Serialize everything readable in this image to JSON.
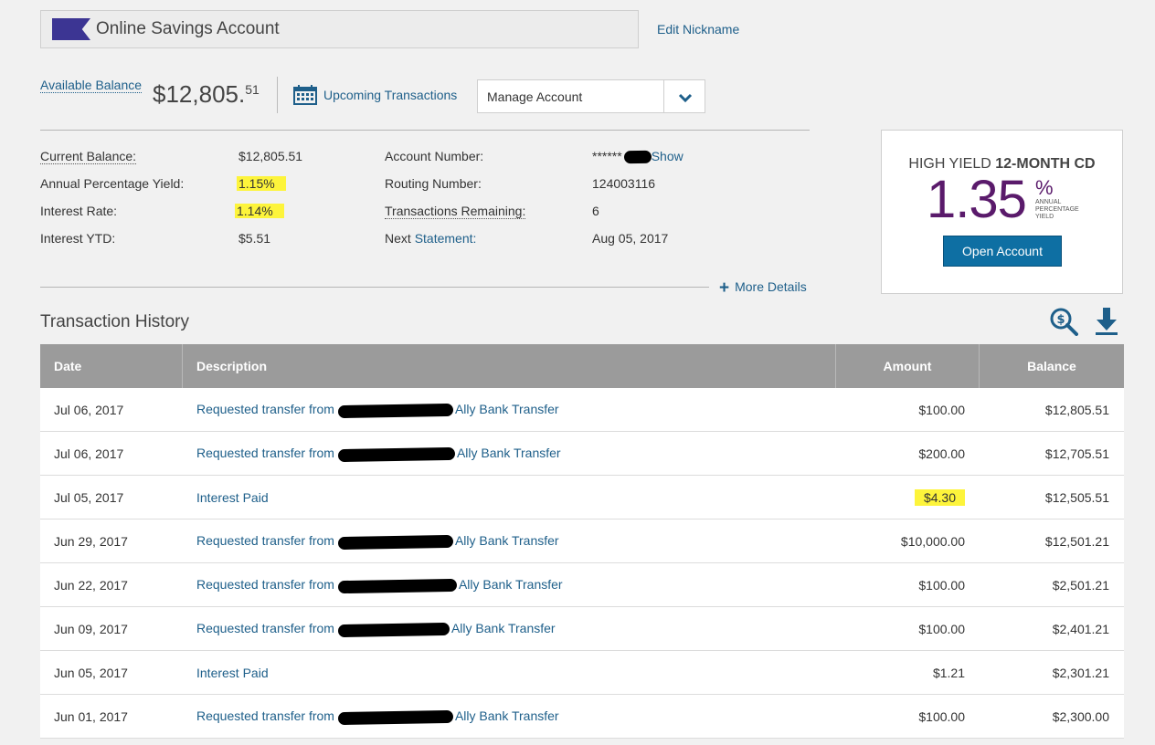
{
  "header": {
    "account_nickname": "Online Savings Account",
    "edit_nickname": "Edit Nickname"
  },
  "balance": {
    "available_label": "Available Balance",
    "amount_main": "$12,805.",
    "amount_cents": "51",
    "upcoming_label": "Upcoming Transactions",
    "manage_account": "Manage Account"
  },
  "details": {
    "current_balance_label": "Current Balance:",
    "current_balance_value": "$12,805.51",
    "apy_label": "Annual Percentage Yield:",
    "apy_value": "1.15%",
    "interest_rate_label": "Interest Rate:",
    "interest_rate_value": "1.14%",
    "interest_ytd_label": "Interest YTD:",
    "interest_ytd_value": "$5.51",
    "account_number_label": "Account Number:",
    "account_number_value": "******",
    "account_number_show": "Show",
    "routing_number_label": "Routing Number:",
    "routing_number_value": "124003116",
    "transactions_remaining_label": "Transactions Remaining:",
    "transactions_remaining_value": "6",
    "next_label": "Next",
    "statement_label": "Statement:",
    "next_statement_value": "Aug 05, 2017",
    "more_details": "More Details"
  },
  "promo": {
    "title_prefix": "HIGH YIELD",
    "title_bold": "12-MONTH CD",
    "rate": "1.35",
    "percent": "%",
    "apy_line1": "ANNUAL",
    "apy_line2": "PERCENTAGE",
    "apy_line3": "YIELD",
    "open_button": "Open Account"
  },
  "history": {
    "title": "Transaction History",
    "columns": {
      "date": "Date",
      "description": "Description",
      "amount": "Amount",
      "balance": "Balance"
    },
    "rows": [
      {
        "date": "Jul 06, 2017",
        "desc_a": "Requested transfer from",
        "desc_b": "Ally Bank Transfer",
        "amount": "$100.00",
        "balance": "$12,805.51"
      },
      {
        "date": "Jul 06, 2017",
        "desc_a": "Requested transfer from",
        "desc_b": "Ally Bank Transfer",
        "amount": "$200.00",
        "balance": "$12,705.51"
      },
      {
        "date": "Jul 05, 2017",
        "desc_a": "Interest Paid",
        "desc_b": "",
        "amount": "$4.30",
        "balance": "$12,505.51"
      },
      {
        "date": "Jun 29, 2017",
        "desc_a": "Requested transfer from",
        "desc_b": "Ally Bank Transfer",
        "amount": "$10,000.00",
        "balance": "$12,501.21"
      },
      {
        "date": "Jun 22, 2017",
        "desc_a": "Requested transfer from",
        "desc_b": "Ally Bank Transfer",
        "amount": "$100.00",
        "balance": "$2,501.21"
      },
      {
        "date": "Jun 09, 2017",
        "desc_a": "Requested transfer from",
        "desc_b": "Ally Bank Transfer",
        "amount": "$100.00",
        "balance": "$2,401.21"
      },
      {
        "date": "Jun 05, 2017",
        "desc_a": "Interest Paid",
        "desc_b": "",
        "amount": "$1.21",
        "balance": "$2,301.21"
      },
      {
        "date": "Jun 01, 2017",
        "desc_a": "Requested transfer from",
        "desc_b": "Ally Bank Transfer",
        "amount": "$100.00",
        "balance": "$2,300.00"
      }
    ]
  },
  "colors": {
    "link": "#1e5f8a",
    "highlight": "#fdf43b",
    "promo_purple": "#5a1a6b",
    "button_blue": "#0e6fa3",
    "table_header": "#9b9b9b"
  },
  "icons": [
    "flag-icon",
    "calendar-icon",
    "chevron-down-icon",
    "plus-icon",
    "search-dollar-icon",
    "download-icon"
  ]
}
